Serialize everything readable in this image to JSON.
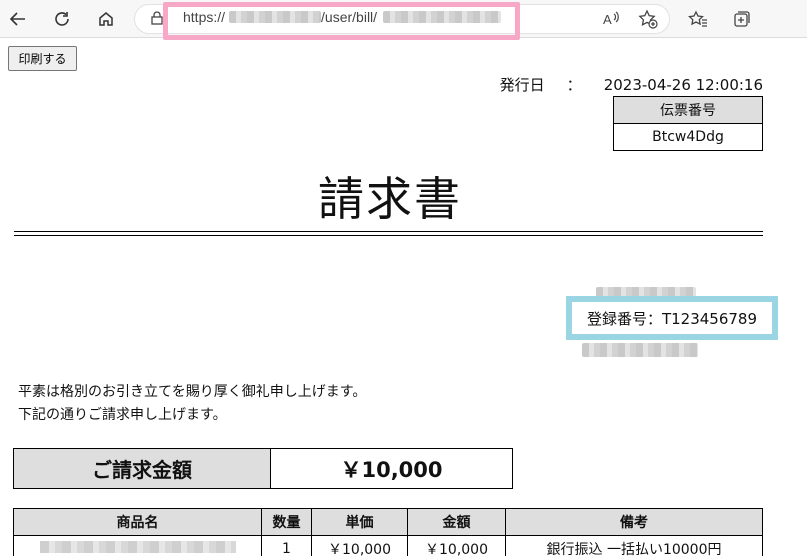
{
  "browser": {
    "url_prefix": "https://",
    "url_path": "/user/bill/"
  },
  "page": {
    "print_button": "印刷する",
    "issue_label": "発行日",
    "issue_separator": "：",
    "issue_datetime": "2023-04-26 12:00:16",
    "slip_header": "伝票番号",
    "slip_number": "Btcw4Ddg",
    "title": "請求書",
    "registration": "登録番号：T123456789",
    "greeting_line1": "平素は格別のお引き立てを賜り厚く御礼申し上げます。",
    "greeting_line2": "下記の通りご請求申し上げます。",
    "total_label": "ご請求金額",
    "total_value": "￥10,000"
  },
  "items": {
    "headers": [
      "商品名",
      "数量",
      "単価",
      "金額",
      "備考"
    ],
    "rows": [
      {
        "qty": "1",
        "unit_price": "￥10,000",
        "amount": "￥10,000",
        "note": "銀行振込 一括払い10000円"
      }
    ]
  },
  "colors": {
    "url_highlight": "#f6a8c6",
    "registration_highlight": "#9ad5e4",
    "table_header_bg": "#dedede"
  }
}
